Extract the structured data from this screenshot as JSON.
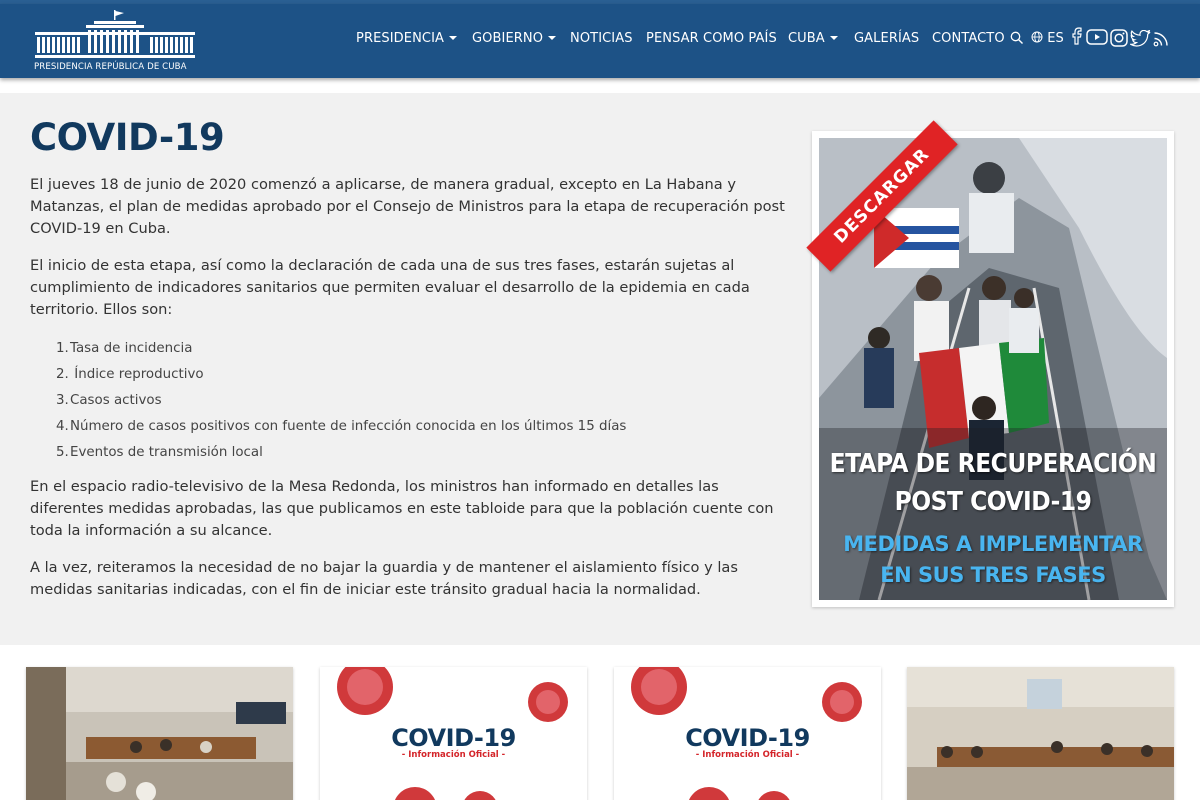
{
  "header": {
    "logo_text": "PRESIDENCIA REPÚBLICA DE CUBA",
    "nav": [
      {
        "label": "PRESIDENCIA",
        "has_dropdown": true
      },
      {
        "label": "GOBIERNO",
        "has_dropdown": true
      },
      {
        "label": "NOTICIAS",
        "has_dropdown": false
      },
      {
        "label": "PENSAR COMO PAÍS",
        "has_dropdown": false
      },
      {
        "label": "CUBA",
        "has_dropdown": true
      },
      {
        "label": "GALERÍAS",
        "has_dropdown": false
      },
      {
        "label": "CONTACTO",
        "has_dropdown": false
      }
    ],
    "language": "ES",
    "icons": [
      "search-icon",
      "globe-icon",
      "facebook-icon",
      "youtube-icon",
      "instagram-icon",
      "twitter-icon",
      "rss-icon"
    ],
    "colors": {
      "bar": "#1d5286",
      "accent": "#11395e"
    }
  },
  "article": {
    "title": "COVID-19",
    "paragraph1": "El jueves 18 de junio de 2020 comenzó a aplicarse, de manera gradual, excepto en La Habana y Matanzas, el plan de medidas aprobado por el Consejo de Ministros para la etapa de recuperación post COVID-19 en Cuba.",
    "paragraph2": "El inicio de esta etapa, así como la declaración de cada una de sus tres fases, estarán sujetas al cumplimiento de indicadores sanitarios que permiten evaluar el desarrollo de la epidemia en cada territorio. Ellos son:",
    "indicators": [
      {
        "num": "1.",
        "text": "Tasa de incidencia"
      },
      {
        "num": "2.",
        "text": " Índice reproductivo"
      },
      {
        "num": "3.",
        "text": "Casos activos"
      },
      {
        "num": "4.",
        "text": "Número de casos positivos con fuente de infección conocida en los últimos 15 días"
      },
      {
        "num": "5.",
        "text": "Eventos de transmisión local"
      }
    ],
    "paragraph3": "En el espacio radio-televisivo de la Mesa Redonda, los ministros han informado en detalles las diferentes medidas aprobadas, las que publicamos en este tabloide para que la población cuente con toda la información a su alcance.",
    "paragraph4": "A la vez, reiteramos la necesidad de no bajar la guardia y de mantener el aislamiento físico y las medidas sanitarias indicadas, con el fin de iniciar este tránsito gradual hacia la normalidad."
  },
  "poster": {
    "ribbon": "DESCARGAR",
    "line1": "ETAPA DE RECUPERACIÓN",
    "line2": "POST COVID-19",
    "line3": "MEDIDAS A IMPLEMENTAR",
    "line4": "EN SUS TRES FASES"
  },
  "cards": [
    {
      "type": "photo"
    },
    {
      "type": "covid",
      "title": "COVID-19",
      "subtitle": "- Información Oficial -"
    },
    {
      "type": "covid",
      "title": "COVID-19",
      "subtitle": "- Información Oficial -"
    },
    {
      "type": "photo"
    }
  ]
}
